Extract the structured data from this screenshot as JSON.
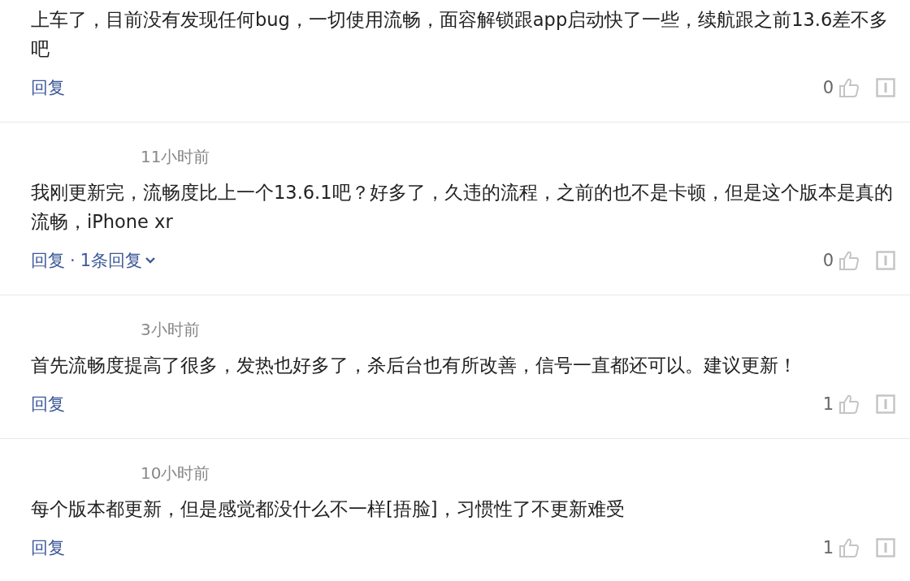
{
  "comments": [
    {
      "text": "上车了，目前没有发现任何bug，一切使用流畅，面容解锁跟app启动快了一些，续航跟之前13.6差不多吧",
      "reply_label": "回复",
      "likes": "0"
    },
    {
      "time": "11小时前",
      "text": "我刚更新完，流畅度比上一个13.6.1吧？好多了，久违的流程，之前的也不是卡顿，但是这个版本是真的流畅，iPhone xr",
      "reply_label": "回复",
      "separator": "·",
      "replies_link": "1条回复",
      "likes": "0"
    },
    {
      "time": "3小时前",
      "text": "首先流畅度提高了很多，发热也好多了，杀后台也有所改善，信号一直都还可以。建议更新！",
      "reply_label": "回复",
      "likes": "1"
    },
    {
      "time": "10小时前",
      "text": "每个版本都更新，但是感觉都没什么不一样[捂脸]，习惯性了不更新难受",
      "reply_label": "回复",
      "likes": "1"
    }
  ]
}
